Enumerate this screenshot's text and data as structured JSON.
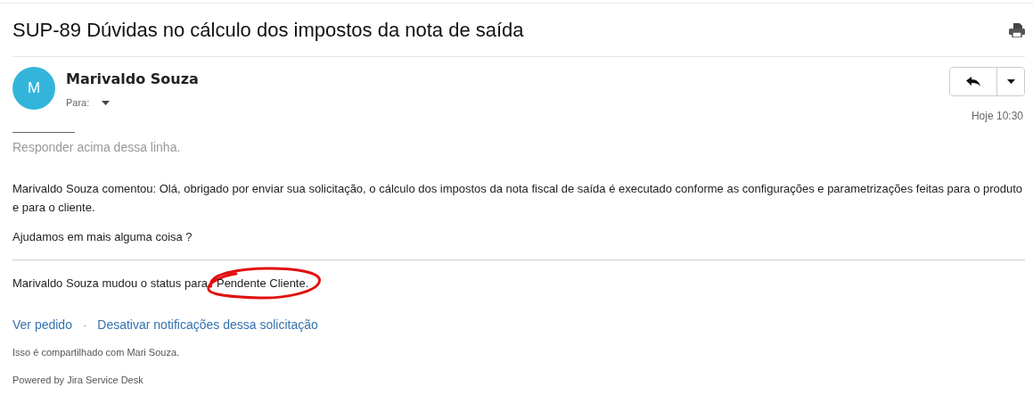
{
  "email": {
    "title": "SUP-89 Dúvidas no cálculo dos impostos da nota de saída",
    "sender": {
      "initial": "M",
      "name": "Marivaldo Souza",
      "to_label": "Para:"
    },
    "time": "Hoje 10:30",
    "reply_hint": "Responder acima dessa linha.",
    "comment": [
      "Marivaldo Souza comentou: Olá, obrigado por enviar sua solicitação, o cálculo dos impostos da nota fiscal de saída é executado conforme as configurações e parametrizações feitas para o produto e para o cliente.",
      "Ajudamos em mais alguma coisa ?"
    ],
    "status_change": {
      "text": "Marivaldo Souza mudou o status para",
      "status": "Pendente Cliente."
    },
    "links": [
      "Ver pedido",
      "Desativar notificações dessa solicitação"
    ],
    "link_separator": "·",
    "shared_note": "Isso é compartilhado com Mari Souza.",
    "footer": "Powered by Jira Service Desk"
  }
}
